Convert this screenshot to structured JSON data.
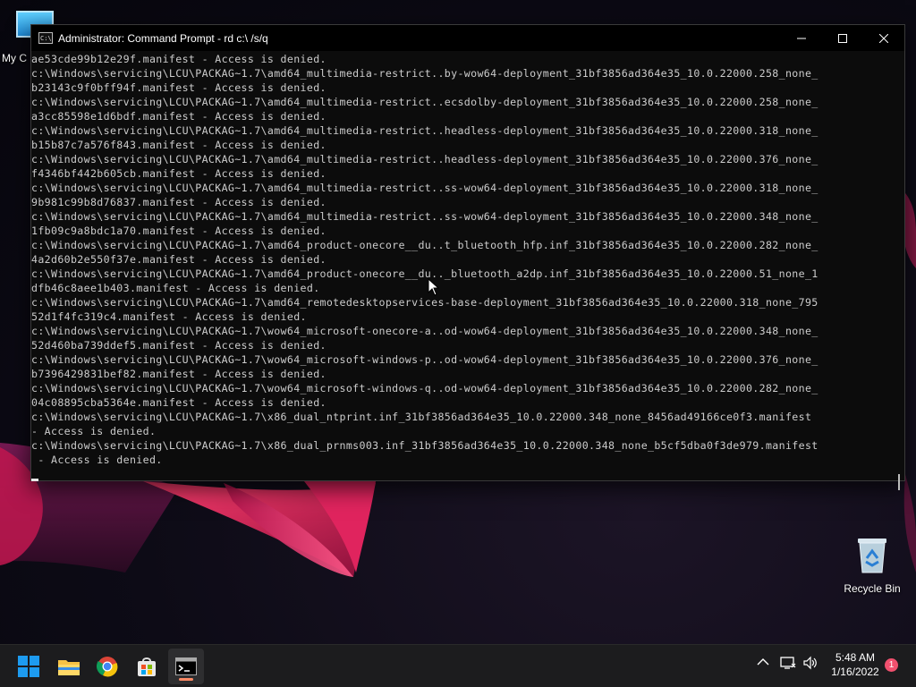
{
  "desktop": {
    "icons": [
      {
        "label": "My C",
        "icon": "this-pc-icon"
      },
      {
        "label": "Recycle Bin",
        "icon": "recycle-bin-icon"
      }
    ]
  },
  "window": {
    "title": "Administrator: Command Prompt - rd  c:\\ /s/q",
    "console_lines": [
      "ae53cde99b12e29f.manifest - Access is denied.",
      "c:\\Windows\\servicing\\LCU\\PACKAG~1.7\\amd64_multimedia-restrict..by-wow64-deployment_31bf3856ad364e35_10.0.22000.258_none_",
      "b23143c9f0bff94f.manifest - Access is denied.",
      "c:\\Windows\\servicing\\LCU\\PACKAG~1.7\\amd64_multimedia-restrict..ecsdolby-deployment_31bf3856ad364e35_10.0.22000.258_none_",
      "a3cc85598e1d6bdf.manifest - Access is denied.",
      "c:\\Windows\\servicing\\LCU\\PACKAG~1.7\\amd64_multimedia-restrict..headless-deployment_31bf3856ad364e35_10.0.22000.318_none_",
      "b15b87c7a576f843.manifest - Access is denied.",
      "c:\\Windows\\servicing\\LCU\\PACKAG~1.7\\amd64_multimedia-restrict..headless-deployment_31bf3856ad364e35_10.0.22000.376_none_",
      "f4346bf442b605cb.manifest - Access is denied.",
      "c:\\Windows\\servicing\\LCU\\PACKAG~1.7\\amd64_multimedia-restrict..ss-wow64-deployment_31bf3856ad364e35_10.0.22000.318_none_",
      "9b981c99b8d76837.manifest - Access is denied.",
      "c:\\Windows\\servicing\\LCU\\PACKAG~1.7\\amd64_multimedia-restrict..ss-wow64-deployment_31bf3856ad364e35_10.0.22000.348_none_",
      "1fb09c9a8bdc1a70.manifest - Access is denied.",
      "c:\\Windows\\servicing\\LCU\\PACKAG~1.7\\amd64_product-onecore__du..t_bluetooth_hfp.inf_31bf3856ad364e35_10.0.22000.282_none_",
      "4a2d60b2e550f37e.manifest - Access is denied.",
      "c:\\Windows\\servicing\\LCU\\PACKAG~1.7\\amd64_product-onecore__du.._bluetooth_a2dp.inf_31bf3856ad364e35_10.0.22000.51_none_1",
      "dfb46c8aee1b403.manifest - Access is denied.",
      "c:\\Windows\\servicing\\LCU\\PACKAG~1.7\\amd64_remotedesktopservices-base-deployment_31bf3856ad364e35_10.0.22000.318_none_795",
      "52d1f4fc319c4.manifest - Access is denied.",
      "c:\\Windows\\servicing\\LCU\\PACKAG~1.7\\wow64_microsoft-onecore-a..od-wow64-deployment_31bf3856ad364e35_10.0.22000.348_none_",
      "52d460ba739ddef5.manifest - Access is denied.",
      "c:\\Windows\\servicing\\LCU\\PACKAG~1.7\\wow64_microsoft-windows-p..od-wow64-deployment_31bf3856ad364e35_10.0.22000.376_none_",
      "b7396429831bef82.manifest - Access is denied.",
      "c:\\Windows\\servicing\\LCU\\PACKAG~1.7\\wow64_microsoft-windows-q..od-wow64-deployment_31bf3856ad364e35_10.0.22000.282_none_",
      "04c08895cba5364e.manifest - Access is denied.",
      "c:\\Windows\\servicing\\LCU\\PACKAG~1.7\\x86_dual_ntprint.inf_31bf3856ad364e35_10.0.22000.348_none_8456ad49166ce0f3.manifest",
      "- Access is denied.",
      "c:\\Windows\\servicing\\LCU\\PACKAG~1.7\\x86_dual_prnms003.inf_31bf3856ad364e35_10.0.22000.348_none_b5cf5dba0f3de979.manifest",
      " - Access is denied."
    ]
  },
  "taskbar": {
    "apps": [
      "start-icon",
      "file-explorer-icon",
      "chrome-icon",
      "store-icon",
      "command-prompt-icon"
    ],
    "time": "5:48 AM",
    "date": "1/16/2022",
    "notification_count": "1"
  },
  "colors": {
    "console_bg": "#0c0c0c",
    "console_text": "#cccccc",
    "taskbar_bg": "#1c1c1e",
    "start_blue": "#1d9bf0"
  }
}
